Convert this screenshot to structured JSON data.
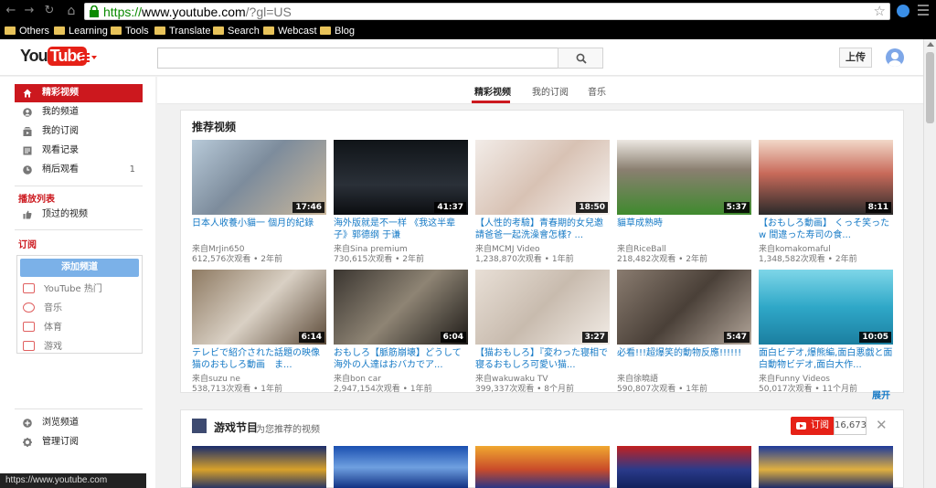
{
  "browser": {
    "url_scheme": "https://",
    "url_host": "www.youtube.com",
    "url_path": "/?gl=US",
    "bookmarks": [
      "Others",
      "Learning",
      "Tools",
      "Translate",
      "Search",
      "Webcast",
      "Blog"
    ],
    "status_text": "https://www.youtube.com"
  },
  "masthead": {
    "logo_you": "You",
    "logo_tube": "Tube",
    "search_placeholder": "",
    "upload_label": "上传"
  },
  "sidebar": {
    "items": [
      {
        "label": "精彩视频",
        "icon": "home-icon"
      },
      {
        "label": "我的频道",
        "icon": "user-icon"
      },
      {
        "label": "我的订阅",
        "icon": "subscriptions-icon"
      },
      {
        "label": "观看记录",
        "icon": "history-icon"
      },
      {
        "label": "稍后观看",
        "icon": "clock-icon",
        "count": "1"
      }
    ],
    "playlists_heading": "播放列表",
    "liked_label": "顶过的视频",
    "subscriptions_heading": "订阅",
    "add_channel_label": "添加频道",
    "channels": [
      {
        "label": "YouTube 热门"
      },
      {
        "label": "音乐"
      },
      {
        "label": "体育"
      },
      {
        "label": "游戏"
      }
    ],
    "browse_label": "浏览频道",
    "manage_label": "管理订阅"
  },
  "tabs": [
    "精彩视频",
    "我的订阅",
    "音乐"
  ],
  "recommended": {
    "title": "推荐视频",
    "expand_label": "展开",
    "videos": [
      {
        "title": "日本人收養小貓一 個月的紀錄",
        "by": "来自MrJin650",
        "views": "612,576次观看",
        "age": "2年前",
        "duration": "17:46"
      },
      {
        "title": "海外版就是不一样 《我这半辈子》郭德纲 于谦",
        "by": "来自Sina premium",
        "views": "730,615次观看",
        "age": "2年前",
        "duration": "41:37"
      },
      {
        "title": "【人性的考驗】青春期的女兒邀請爸爸一起洗澡會怎樣? ...",
        "by": "来自MCMJ Video",
        "views": "1,238,870次观看",
        "age": "1年前",
        "duration": "18:50"
      },
      {
        "title": "貓草成熟時",
        "by": "来自RiceBall",
        "views": "218,482次观看",
        "age": "2年前",
        "duration": "5:37"
      },
      {
        "title": "【おもしろ動画】 くっそ笑ったw 間違った寿司の食...",
        "by": "来自komakomaful",
        "views": "1,348,582次观看",
        "age": "2年前",
        "duration": "8:11"
      },
      {
        "title": "テレビで紹介された話題の映像　猫のおもしろ動画　ま...",
        "by": "来自suzu ne",
        "views": "538,713次观看",
        "age": "1年前",
        "duration": "6:14"
      },
      {
        "title": "おもしろ【脈筋崩壊】どうして海外の人達はおバカでア...",
        "by": "来自bon car",
        "views": "2,947,154次观看",
        "age": "1年前",
        "duration": "6:04"
      },
      {
        "title": "【猫おもしろ】『変わった寝相で寝るおもしろ可愛い猫...",
        "by": "来自wakuwaku TV",
        "views": "399,337次观看",
        "age": "8个月前",
        "duration": "3:27"
      },
      {
        "title": "必看!!!超爆笑的動物反應!!!!!!",
        "by": "来自徐曉語",
        "views": "590,807次观看",
        "age": "1年前",
        "duration": "5:47"
      },
      {
        "title": "面白ビデオ,爆熊編,面白悪戯と面白動物ビデオ,面白大作...",
        "by": "来自Funny Videos",
        "views": "50,017次观看",
        "age": "11个月前",
        "duration": "10:05"
      }
    ]
  },
  "games_shelf": {
    "title": "游戏节目",
    "subtitle": "为您推荐的视频",
    "subscribe_label": "订阅",
    "subscriber_count": "16,673"
  },
  "colors": {
    "brand_red": "#e62117",
    "link_blue": "#167ac6",
    "active_red": "#cc181e"
  }
}
